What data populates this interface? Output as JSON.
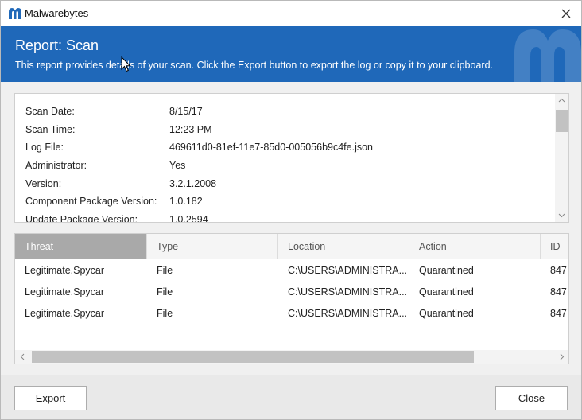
{
  "window": {
    "app_name": "Malwarebytes"
  },
  "colors": {
    "brand_blue": "#1f68b9",
    "header_active": "#a9a9a9"
  },
  "banner": {
    "title": "Report: Scan",
    "subtitle": "This report provides details of your scan. Click the Export button to export the log or copy it to your clipboard."
  },
  "details": [
    {
      "label": "Scan Date:",
      "value": "8/15/17"
    },
    {
      "label": "Scan Time:",
      "value": "12:23 PM"
    },
    {
      "label": "Log File:",
      "value": "469611d0-81ef-11e7-85d0-005056b9c4fe.json"
    },
    {
      "label": "Administrator:",
      "value": "Yes"
    },
    {
      "label": "Version:",
      "value": "3.2.1.2008"
    },
    {
      "label": "Component Package Version:",
      "value": "1.0.182"
    },
    {
      "label": "Update Package Version:",
      "value": "1.0.2594"
    }
  ],
  "table": {
    "columns": [
      "Threat",
      "Type",
      "Location",
      "Action",
      "ID"
    ],
    "active_column": "Threat",
    "rows": [
      [
        "Legitimate.Spycar",
        "File",
        "C:\\USERS\\ADMINISTRA...",
        "Quarantined",
        "847"
      ],
      [
        "Legitimate.Spycar",
        "File",
        "C:\\USERS\\ADMINISTRA...",
        "Quarantined",
        "847"
      ],
      [
        "Legitimate.Spycar",
        "File",
        "C:\\USERS\\ADMINISTRA...",
        "Quarantined",
        "847"
      ]
    ]
  },
  "buttons": {
    "export": "Export",
    "close": "Close"
  },
  "icons": {
    "logo": "malwarebytes-logo-icon",
    "close": "close-icon",
    "scroll_up": "chevron-up-icon",
    "scroll_down": "chevron-down-icon",
    "scroll_left": "chevron-left-icon",
    "scroll_right": "chevron-right-icon"
  }
}
